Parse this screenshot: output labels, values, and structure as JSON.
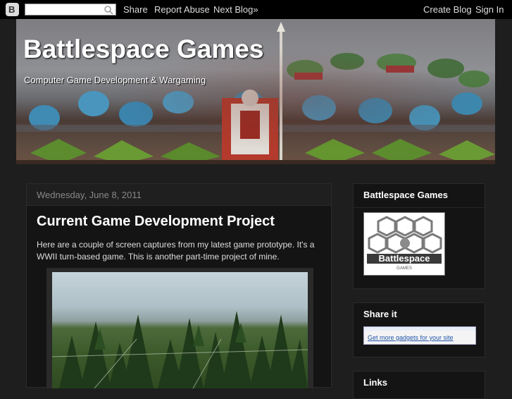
{
  "navbar": {
    "search_placeholder": "",
    "share": "Share",
    "report_abuse": "Report Abuse",
    "next_blog": "Next Blog»",
    "create_blog": "Create Blog",
    "sign_in": "Sign In"
  },
  "header": {
    "title": "Battlespace Games",
    "description": "Computer Game Development & Wargaming"
  },
  "post": {
    "date": "Wednesday, June 8, 2011",
    "title": "Current Game Development Project",
    "body": "Here are a couple of screen captures from my latest game prototype. It's a WWII turn-based game. This is another part-time project of mine."
  },
  "sidebar": {
    "profile_title": "Battlespace Games",
    "logo_text": "Battlespace",
    "logo_subtext": "GAMES",
    "share_title": "Share it",
    "gadget_link": "Get more gadgets for your site",
    "links_title": "Links"
  },
  "colors": {
    "background": "#1e1e1e",
    "navbar": "#000000",
    "link": "#2255aa"
  }
}
